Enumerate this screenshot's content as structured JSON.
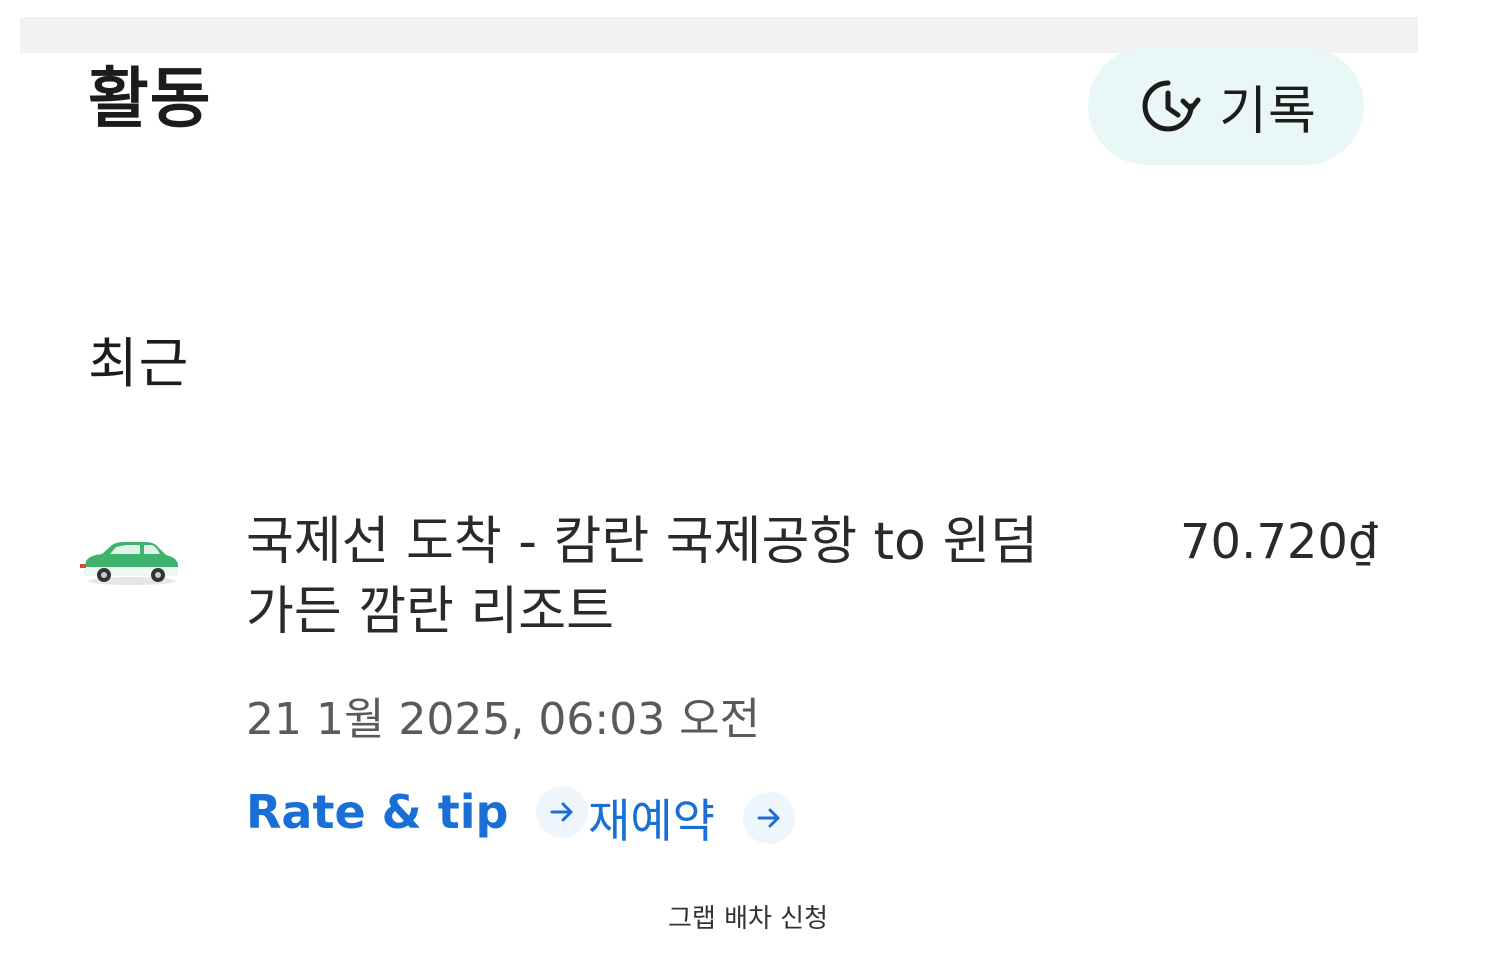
{
  "header": {
    "title": "활동",
    "history_button_label": "기록"
  },
  "section": {
    "title": "최근"
  },
  "activity": {
    "trip_title": "국제선 도착 - 캄란 국제공항 to 윈덤 가든 깜란 리조트",
    "price": "70.720₫",
    "date": "21 1월 2025, 06:03 오전",
    "rate_tip_label": "Rate & tip",
    "rebook_label": "재예약"
  },
  "caption": "그랩 배차 신청",
  "icons": {
    "history": "history-icon",
    "vehicle": "car-icon",
    "arrow": "arrow-right-icon"
  },
  "colors": {
    "accent": "#1a6fd6",
    "history_button_bg": "#e9f7f6",
    "car_green": "#3fb36b"
  }
}
